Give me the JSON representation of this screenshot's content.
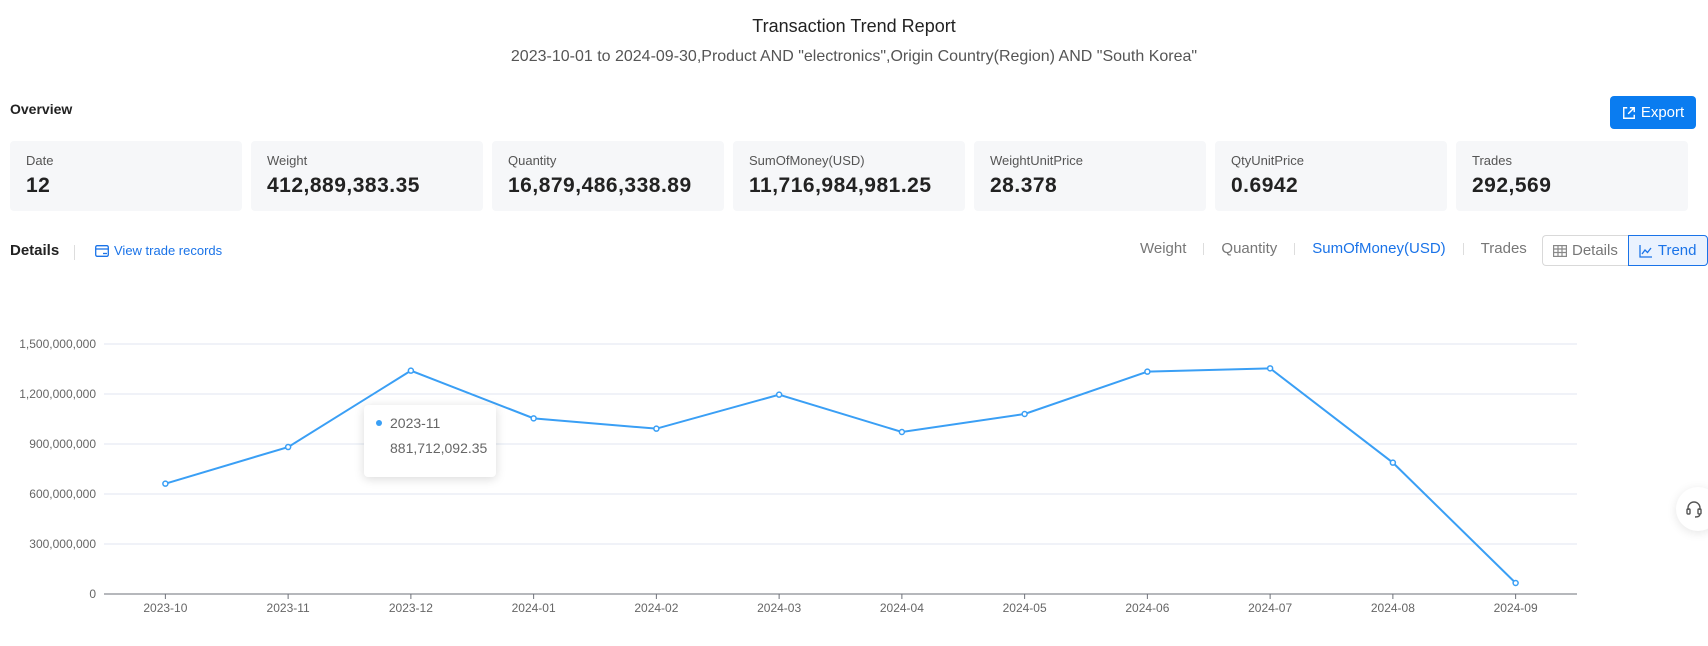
{
  "header": {
    "title": "Transaction Trend Report",
    "subtitle": "2023-10-01 to 2024-09-30,Product AND \"electronics\",Origin Country(Region) AND \"South Korea\""
  },
  "overview": {
    "label": "Overview",
    "export_label": "Export",
    "cards": [
      {
        "label": "Date",
        "value": "12"
      },
      {
        "label": "Weight",
        "value": "412,889,383.35"
      },
      {
        "label": "Quantity",
        "value": "16,879,486,338.89"
      },
      {
        "label": "SumOfMoney(USD)",
        "value": "11,716,984,981.25"
      },
      {
        "label": "WeightUnitPrice",
        "value": "28.378"
      },
      {
        "label": "QtyUnitPrice",
        "value": "0.6942"
      },
      {
        "label": "Trades",
        "value": "292,569"
      }
    ]
  },
  "details": {
    "label": "Details",
    "view_records_label": "View trade records",
    "metric_tabs": [
      {
        "label": "Weight",
        "active": false
      },
      {
        "label": "Quantity",
        "active": false
      },
      {
        "label": "SumOfMoney(USD)",
        "active": true
      },
      {
        "label": "Trades",
        "active": false
      }
    ],
    "view_toggle": {
      "details_label": "Details",
      "trend_label": "Trend",
      "active": "Trend"
    }
  },
  "tooltip": {
    "category": "2023-11",
    "value": "881,712,092.35"
  },
  "colors": {
    "accent": "#1a73e8",
    "line": "#3a9ff5",
    "export_button": "#0a7cf0"
  },
  "chart_data": {
    "type": "line",
    "title": "",
    "xlabel": "",
    "ylabel": "",
    "categories": [
      "2023-10",
      "2023-11",
      "2023-12",
      "2024-01",
      "2024-02",
      "2024-03",
      "2024-04",
      "2024-05",
      "2024-06",
      "2024-07",
      "2024-08",
      "2024-09"
    ],
    "series": [
      {
        "name": "SumOfMoney(USD)",
        "values": [
          662000000,
          881712092.35,
          1340000000,
          1054000000,
          992000000,
          1196000000,
          972000000,
          1080000000,
          1334000000,
          1354000000,
          788000000,
          66000000
        ]
      }
    ],
    "ylim": [
      0,
      1500000000
    ],
    "yticks": [
      0,
      300000000,
      600000000,
      900000000,
      1200000000,
      1500000000
    ],
    "ytick_labels": [
      "0",
      "300,000,000",
      "600,000,000",
      "900,000,000",
      "1,200,000,000",
      "1,500,000,000"
    ],
    "grid": true,
    "legend": "none"
  }
}
